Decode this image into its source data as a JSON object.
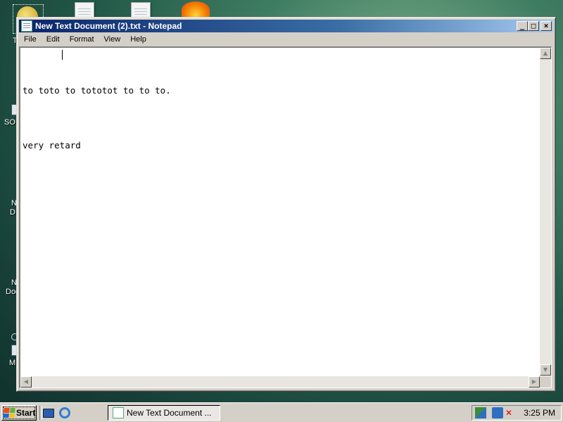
{
  "window": {
    "title": "New Text Document (2).txt - Notepad",
    "menu": [
      "File",
      "Edit",
      "Format",
      "View",
      "Help"
    ],
    "buttons": {
      "minimize": "_",
      "maximize": "□",
      "close": "×"
    }
  },
  "document": {
    "lines": [
      "to toto to tototot to to to.",
      "very retard"
    ]
  },
  "desktop": {
    "labels": [
      "T",
      "SO",
      "N",
      "D",
      "N",
      "Doc",
      "M"
    ]
  },
  "taskbar": {
    "start_label": "Start",
    "task_button_label": "New Text Document ...",
    "clock": "3:25 PM"
  },
  "colors": {
    "titlebar_start": "#0a246a",
    "titlebar_end": "#a6caf0",
    "face": "#d4d0c8"
  }
}
